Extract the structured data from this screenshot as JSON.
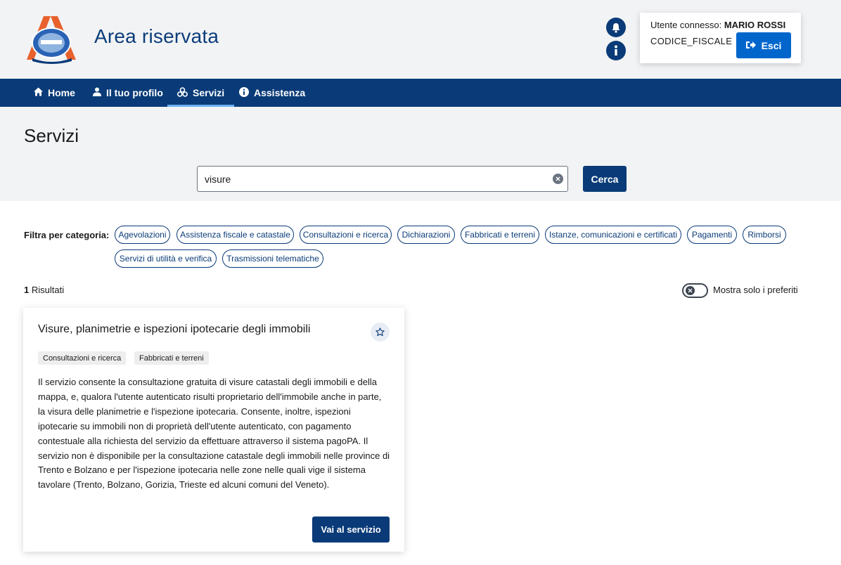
{
  "header": {
    "title": "Area riservata",
    "user_label": "Utente connesso:",
    "user_name": "MARIO ROSSI",
    "fiscal_code": "CODICE_FISCALE",
    "logout_label": "Esci",
    "logo_icon": "agenzia-entrate-logo",
    "bell_icon": "bell-icon",
    "info_icon": "info-icon"
  },
  "nav": {
    "items": [
      {
        "label": "Home",
        "icon": "home-icon"
      },
      {
        "label": "Il tuo profilo",
        "icon": "user-icon"
      },
      {
        "label": "Servizi",
        "icon": "services-icon",
        "active": true
      },
      {
        "label": "Assistenza",
        "icon": "info-icon"
      }
    ]
  },
  "page": {
    "title": "Servizi"
  },
  "search": {
    "value": "visure",
    "button_label": "Cerca"
  },
  "filters": {
    "label": "Filtra per categoria:",
    "chips": [
      "Agevolazioni",
      "Assistenza fiscale e catastale",
      "Consultazioni e ricerca",
      "Dichiarazioni",
      "Fabbricati e terreni",
      "Istanze, comunicazioni e certificati",
      "Pagamenti",
      "Rimborsi",
      "Servizi di utilità e verifica",
      "Trasmissioni telematiche"
    ]
  },
  "results": {
    "count": "1",
    "label": "Risultati",
    "favorites_toggle_label": "Mostra solo i preferiti"
  },
  "card": {
    "title": "Visure, planimetrie e ispezioni ipotecarie degli immobili",
    "tags": [
      "Consultazioni e ricerca",
      "Fabbricati e terreni"
    ],
    "description": "Il servizio consente la consultazione gratuita di visure catastali degli immobili e della mappa, e, qualora l'utente autenticato risulti proprietario dell'immobile anche in parte, la visura delle planimetrie e l'ispezione ipotecaria. Consente, inoltre, ispezioni ipotecarie su immobili non di proprietà dell'utente autenticato, con pagamento contestuale alla richiesta del servizio da effettuare attraverso il sistema pagoPA. Il servizio non è disponibile per la consultazione catastale degli immobili nelle province di Trento e Bolzano e per l'ispezione ipotecaria nelle zone nelle quali vige il sistema tavolare (Trento, Bolzano, Gorizia, Trieste ed alcuni comuni del Veneto).",
    "button_label": "Vai al servizio",
    "favorite_icon": "star-icon"
  },
  "colors": {
    "primary": "#0a3b78",
    "accent_blue": "#0066cc",
    "band_gray": "#f2f3f5",
    "logo_orange": "#e8612c"
  }
}
